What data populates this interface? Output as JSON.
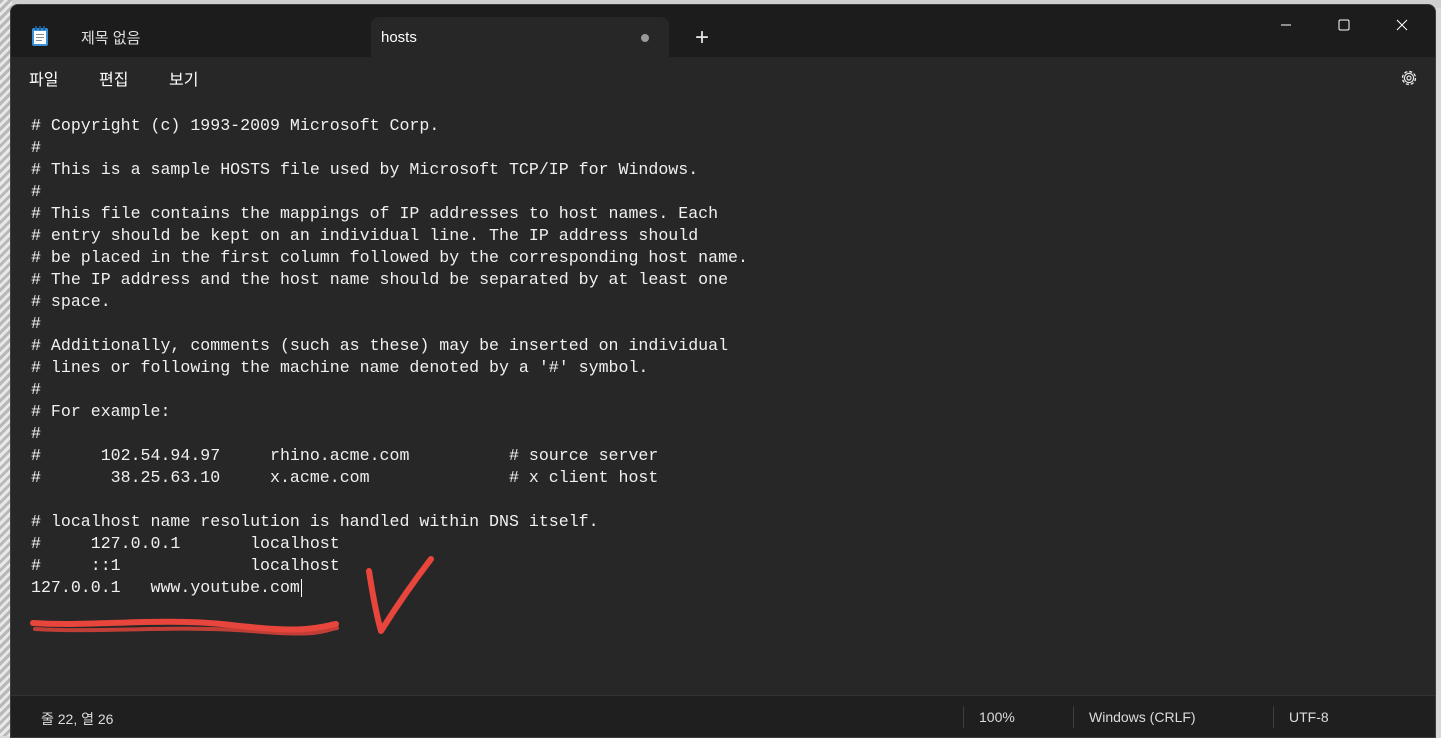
{
  "tabs": [
    {
      "label": "제목 없음",
      "active": false
    },
    {
      "label": "hosts",
      "active": true,
      "unsaved": true
    }
  ],
  "icons": {
    "app": "notepad-icon",
    "new_tab": "plus-icon",
    "minimize": "minimize-icon",
    "maximize": "maximize-icon",
    "close": "close-icon",
    "settings": "gear-icon"
  },
  "new_tab_symbol": "+",
  "menu": {
    "file": "파일",
    "edit": "편집",
    "view": "보기"
  },
  "editor": {
    "lines": [
      "# Copyright (c) 1993-2009 Microsoft Corp.",
      "#",
      "# This is a sample HOSTS file used by Microsoft TCP/IP for Windows.",
      "#",
      "# This file contains the mappings of IP addresses to host names. Each",
      "# entry should be kept on an individual line. The IP address should",
      "# be placed in the first column followed by the corresponding host name.",
      "# The IP address and the host name should be separated by at least one",
      "# space.",
      "#",
      "# Additionally, comments (such as these) may be inserted on individual",
      "# lines or following the machine name denoted by a '#' symbol.",
      "#",
      "# For example:",
      "#",
      "#      102.54.94.97     rhino.acme.com          # source server",
      "#       38.25.63.10     x.acme.com              # x client host",
      "",
      "# localhost name resolution is handled within DNS itself.",
      "#     127.0.0.1       localhost",
      "#     ::1             localhost",
      "127.0.0.1   www.youtube.com"
    ]
  },
  "annotation_color": "#e8453c",
  "status": {
    "position": "줄 22, 열 26",
    "zoom": "100%",
    "line_ending": "Windows (CRLF)",
    "encoding": "UTF-8"
  }
}
